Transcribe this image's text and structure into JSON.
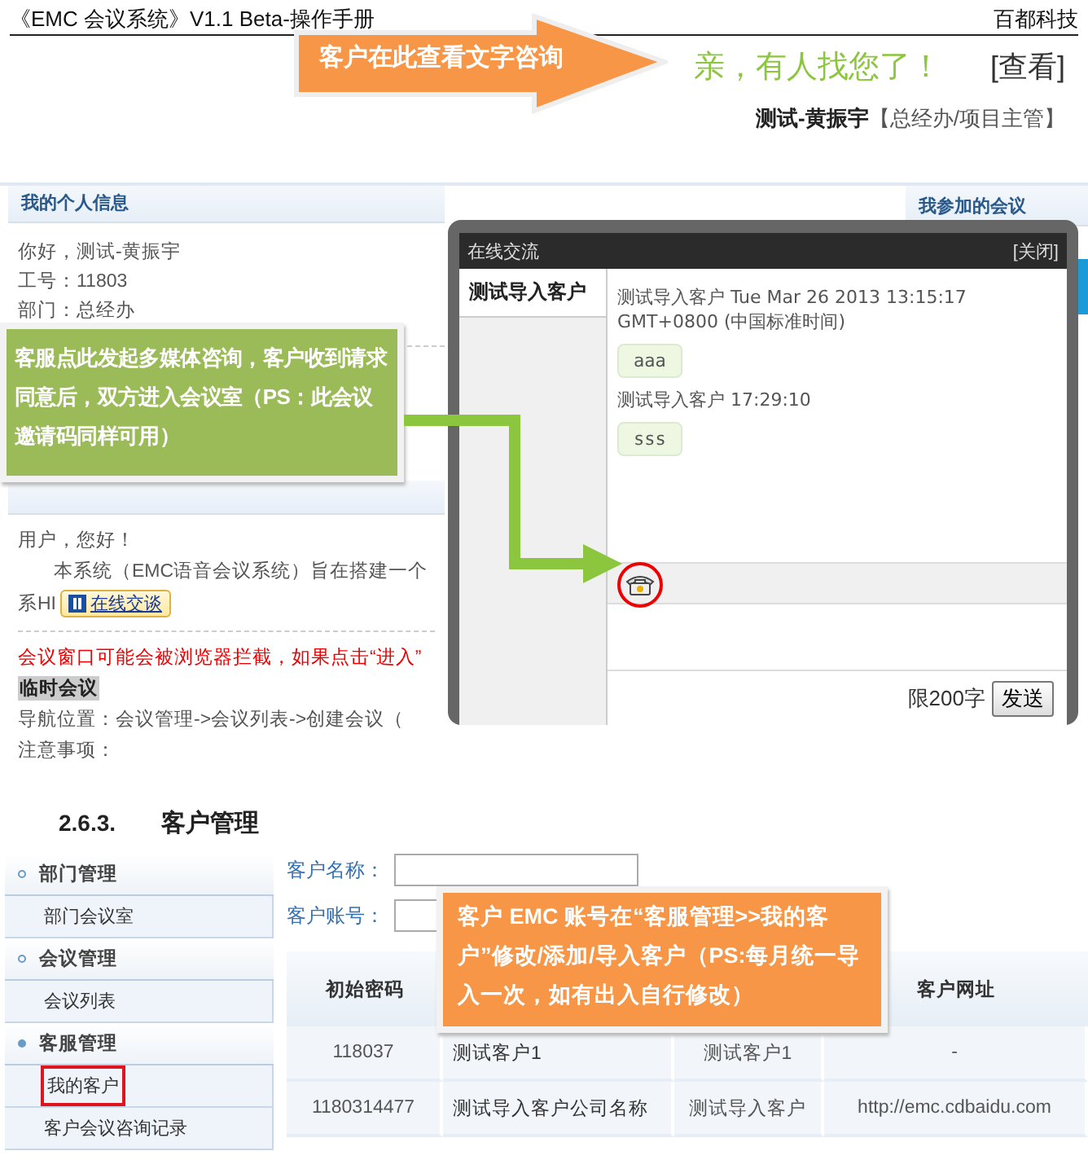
{
  "document": {
    "title": "《EMC 会议系统》V1.1 Beta-操作手册",
    "company": "百都科技"
  },
  "top_screenshot": {
    "notice": "亲，有人找您了！",
    "view_link": "[查看]",
    "user_name": "测试-黄振宇",
    "user_role": "【总经办/项目主管】"
  },
  "top_callout": {
    "text": "客户在此查看文字咨询"
  },
  "home_screenshot": {
    "info_panel": {
      "title": "我的个人信息",
      "lines": [
        "你好，测试-黄振宇",
        "工号：11803",
        "部门：总经办"
      ]
    },
    "welcome": {
      "greeting": "用户，您好！",
      "intro": "本系统（EMC语音会议系统）旨在搭建一个",
      "intro_cont": "系HI",
      "online_badge": "在线交谈",
      "warning": "会议窗口可能会被浏览器拦截，如果点击“进入”",
      "temp_meeting": "临时会议",
      "nav": "导航位置：会议管理->会议列表->创建会议（",
      "notes": "注意事项："
    },
    "meetings_panel": {
      "title": "我参加的会议"
    }
  },
  "chat_dialog": {
    "title": "在线交流",
    "close": "[关闭]",
    "contacts": [
      {
        "name": "测试导入客户",
        "selected": true
      }
    ],
    "messages": [
      {
        "header": "测试导入客户 Tue Mar 26 2013 13:15:17 GMT+0800 (中国标准时间)",
        "text": "aaa"
      },
      {
        "header": "测试导入客户 17:29:10",
        "text": "sss"
      }
    ],
    "limit": "限200字",
    "send": "发送"
  },
  "green_callout": {
    "text": "客服点此发起多媒体咨询，客户收到请求同意后，双方进入会议室（PS：此会议邀请码同样可用）"
  },
  "section": {
    "number": "2.6.3.",
    "title": "客户管理"
  },
  "customer_screenshot": {
    "sidebar": [
      {
        "kind": "group",
        "label": "部门管理",
        "selected": false
      },
      {
        "kind": "item",
        "label": "部门会议室",
        "highlighted": false
      },
      {
        "kind": "group",
        "label": "会议管理",
        "selected": false
      },
      {
        "kind": "item",
        "label": "会议列表",
        "highlighted": false
      },
      {
        "kind": "group",
        "label": "客服管理",
        "selected": true
      },
      {
        "kind": "item",
        "label": "我的客户",
        "highlighted": true
      },
      {
        "kind": "item",
        "label": "客户会议咨询记录",
        "highlighted": false
      }
    ],
    "form": [
      {
        "label": "客户名称："
      },
      {
        "label": "客户账号："
      }
    ],
    "table": {
      "column_1": "初始密码",
      "column_4": "客户网址",
      "rows": [
        [
          "118037",
          "测试客户1",
          "测试客户1",
          "-"
        ],
        [
          "1180314477",
          "测试导入客户公司名称",
          "测试导入客户",
          "http://emc.cdbaidu.com"
        ]
      ]
    }
  },
  "bottom_callout": {
    "text": "客户 EMC 账号在“客服管理>>我的客户”修改/添加/导入客户（PS:每月统一导入一次，如有出入自行修改）"
  }
}
